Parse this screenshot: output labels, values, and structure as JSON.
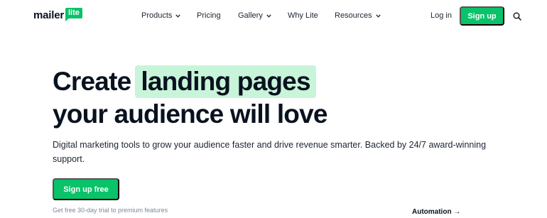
{
  "logo": {
    "word": "mailer",
    "badge": "lite"
  },
  "nav": {
    "items": [
      {
        "label": "Products",
        "has_dropdown": true
      },
      {
        "label": "Pricing",
        "has_dropdown": false
      },
      {
        "label": "Gallery",
        "has_dropdown": true
      },
      {
        "label": "Why Lite",
        "has_dropdown": false
      },
      {
        "label": "Resources",
        "has_dropdown": true
      }
    ],
    "login_label": "Log in",
    "signup_label": "Sign up",
    "search_icon": "search-icon"
  },
  "hero": {
    "headline_prefix": "Create",
    "headline_highlight": "landing pages",
    "headline_line2": "your audience will love",
    "subtext": "Digital marketing tools to grow your audience faster and drive revenue smarter. Backed by 24/7 award-winning support.",
    "cta_label": "Sign up free",
    "trial_note": "Get free 30-day trial to premium features",
    "automation_label": "Automation →"
  },
  "colors": {
    "brand_green": "#09c269",
    "highlight_green": "#c8f4d9",
    "text_dark": "#09121f",
    "muted": "#7f8896"
  }
}
